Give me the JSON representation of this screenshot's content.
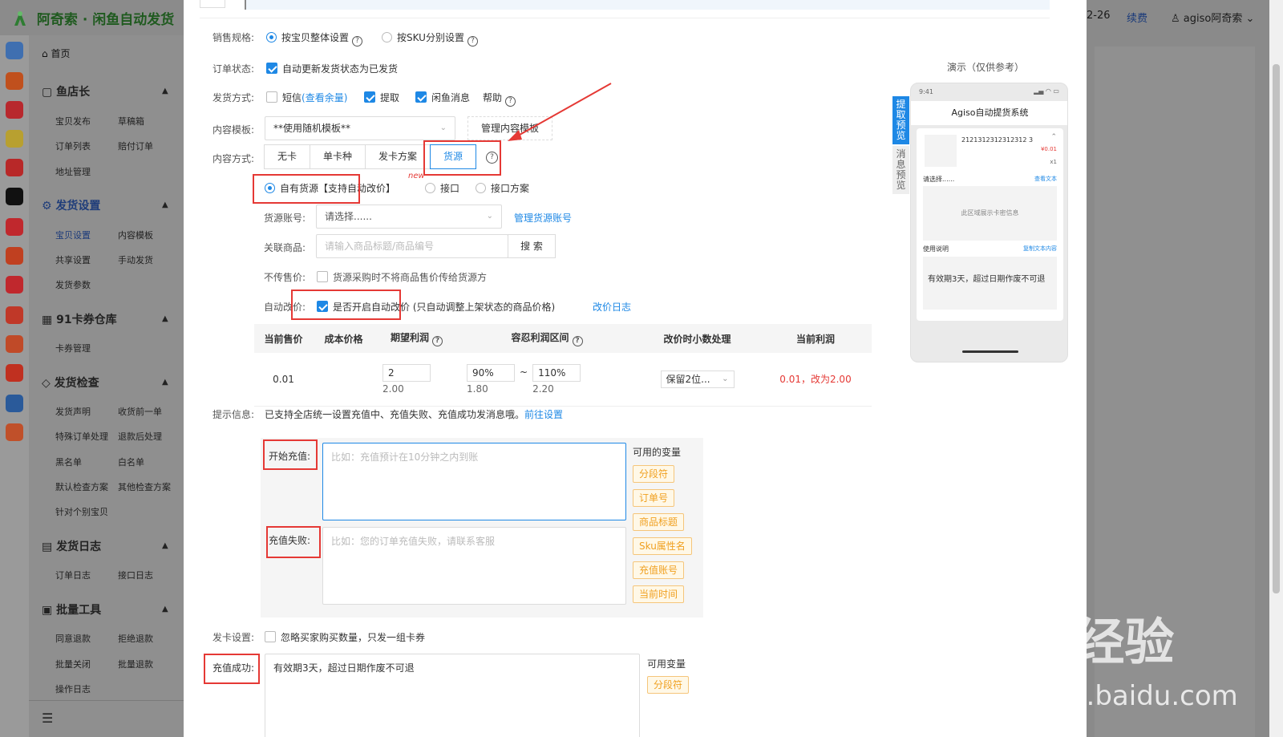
{
  "app": {
    "title": "阿奇索 · 闲鱼自动发货",
    "date_partial": "2-26",
    "renew": "续费",
    "user": "agiso阿奇索"
  },
  "sidebar": {
    "home": "首页",
    "groups": [
      {
        "title": "鱼店长",
        "items": [
          "宝贝发布",
          "草稿箱",
          "订单列表",
          "赔付订单",
          "地址管理"
        ]
      },
      {
        "title": "发货设置",
        "items": [
          "宝贝设置",
          "内容模板",
          "共享设置",
          "手动发货",
          "发货参数"
        ]
      },
      {
        "title": "91卡券仓库",
        "items": [
          "卡券管理"
        ]
      },
      {
        "title": "发货检查",
        "items": [
          "发货声明",
          "收货前一单",
          "特殊订单处理",
          "退款后处理",
          "黑名单",
          "白名单",
          "默认检查方案",
          "其他检查方案",
          "针对个别宝贝"
        ]
      },
      {
        "title": "发货日志",
        "items": [
          "订单日志",
          "接口日志"
        ]
      },
      {
        "title": "批量工具",
        "items": [
          "同意退款",
          "拒绝退款",
          "批量关闭",
          "批量退款",
          "操作日志"
        ]
      }
    ]
  },
  "form": {
    "spec": {
      "label": "销售规格:",
      "opt1": "按宝贝整体设置",
      "opt2": "按SKU分别设置"
    },
    "order_status": {
      "label": "订单状态:",
      "text": "自动更新发货状态为已发货"
    },
    "ship_method": {
      "label": "发货方式:",
      "sms": "短信",
      "sms_link": "(查看余量)",
      "pickup": "提取",
      "xianyu": "闲鱼消息",
      "help": "帮助"
    },
    "template": {
      "label": "内容模板:",
      "value": "**使用随机模板**",
      "manage": "管理内容模板"
    },
    "content": {
      "label": "内容方式:",
      "tabs": [
        "无卡",
        "单卡种",
        "发卡方案",
        "货源"
      ]
    },
    "source": {
      "own": "自有货源【支持自动改价】",
      "new": "new",
      "api": "接口",
      "api_plan": "接口方案"
    },
    "account": {
      "label": "货源账号:",
      "placeholder": "请选择......",
      "manage": "管理货源账号"
    },
    "goods": {
      "label": "关联商品:",
      "placeholder": "请输入商品标题/商品编号",
      "search": "搜 索"
    },
    "no_price": {
      "label": "不传售价:",
      "text": "货源采购时不将商品售价传给货源方"
    },
    "auto_price": {
      "label": "自动改价:",
      "text": "是否开启自动改价 (只自动调整上架状态的商品价格)",
      "log": "改价日志"
    },
    "price_table": {
      "headers": [
        "当前售价",
        "成本价格",
        "期望利润",
        "容忍利润区间",
        "改价时小数处理",
        "当前利润"
      ],
      "row": {
        "price": "0.01",
        "profit_input": "2",
        "profit_sub": "2.00",
        "low": "90%",
        "low_sub": "1.80",
        "tilde": "~",
        "high": "110%",
        "high_sub": "2.20",
        "decimal": "保留2位...",
        "current": "0.01，改为2.00"
      }
    },
    "tip": {
      "label": "提示信息:",
      "text": "已支持全店统一设置充值中、充值失败、充值成功发消息哦。",
      "link": "前往设置"
    },
    "start": {
      "label": "开始充值:",
      "placeholder": "比如：充值预计在10分钟之内到账"
    },
    "fail": {
      "label": "充值失败:",
      "placeholder": "比如：您的订单充值失败，请联系客服"
    },
    "vars_title": "可用的变量",
    "vars": [
      "分段符",
      "订单号",
      "商品标题",
      "Sku属性名",
      "充值账号",
      "当前时间"
    ],
    "card": {
      "label": "发卡设置:",
      "text": "忽略买家购买数量，只发一组卡券"
    },
    "success": {
      "label": "充值成功:",
      "value": "有效期3天，超过日期作废不可退",
      "vars_title": "可用变量",
      "var": "分段符"
    }
  },
  "preview": {
    "title": "演示（仅供参考）",
    "tab1": "提取预览",
    "tab2": "消息预览",
    "time": "9:41",
    "app_title": "Agiso自动提货系统",
    "order_no": "2121312312312312 3",
    "price": "¥0.01",
    "qty": "x1",
    "choose": "请选择......",
    "view_text": "查看文本",
    "card_area": "此区域展示卡密信息",
    "usage": "使用说明",
    "copy_text": "复制文本内容",
    "note": "有效期3天，超过日期作废不可退"
  },
  "watermark": {
    "brand": "Bai经验",
    "url": "jingyan.baidu.com"
  }
}
